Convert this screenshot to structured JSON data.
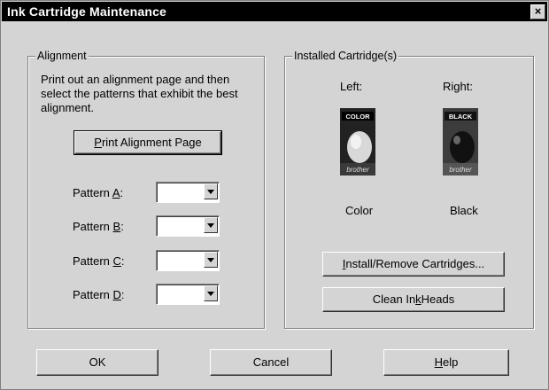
{
  "window": {
    "title": "Ink Cartridge Maintenance",
    "close_glyph": "×"
  },
  "alignment": {
    "legend": "Alignment",
    "instructions": "Print out an alignment page and then select the patterns that exhibit the best alignment.",
    "print_button": {
      "before": "",
      "mnemonic": "P",
      "after": "rint Alignment Page"
    },
    "patterns": [
      {
        "before": "Pattern ",
        "mnemonic": "A",
        "after": ":",
        "value": ""
      },
      {
        "before": "Pattern ",
        "mnemonic": "B",
        "after": ":",
        "value": ""
      },
      {
        "before": "Pattern ",
        "mnemonic": "C",
        "after": ":",
        "value": ""
      },
      {
        "before": "Pattern ",
        "mnemonic": "D",
        "after": ":",
        "value": ""
      }
    ]
  },
  "cartridges": {
    "legend": "Installed Cartridge(s)",
    "left": {
      "heading": "Left:",
      "label": "COLOR",
      "brand": "brother",
      "caption": "Color"
    },
    "right": {
      "heading": "Right:",
      "label": "BLACK",
      "brand": "brother",
      "caption": "Black"
    },
    "install_button": {
      "before": "",
      "mnemonic": "I",
      "after": "nstall/Remove Cartridges..."
    },
    "clean_button": {
      "before": "Clean In",
      "mnemonic": "k",
      "after": " Heads"
    }
  },
  "footer": {
    "ok": "OK",
    "cancel": "Cancel",
    "help": {
      "before": "",
      "mnemonic": "H",
      "after": "elp"
    }
  }
}
